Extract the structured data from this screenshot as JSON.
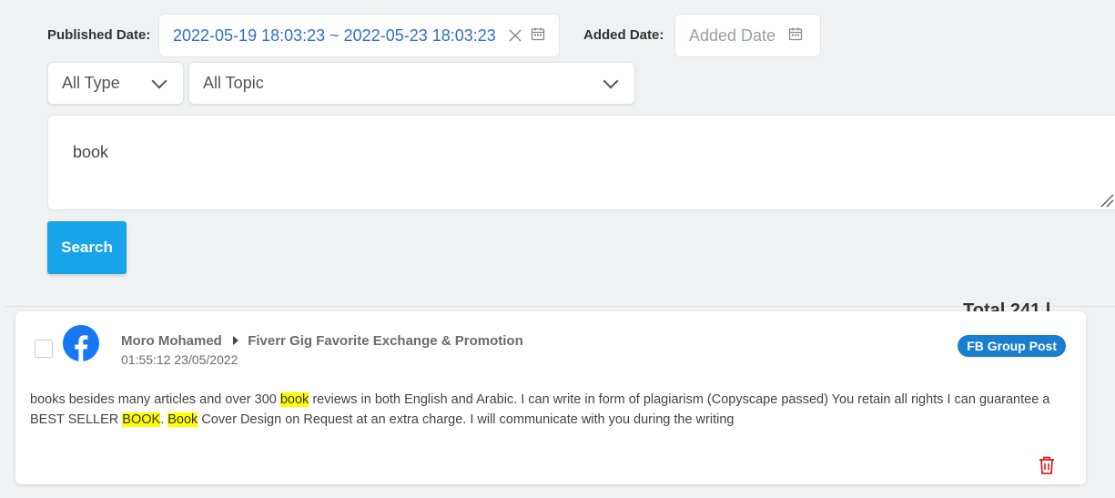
{
  "filters": {
    "published_label": "Published Date:",
    "published_value": "2022-05-19 18:03:23 ~ 2022-05-23 18:03:23",
    "added_label": "Added Date:",
    "added_placeholder": "Added Date",
    "type_select": "All Type",
    "topic_select": "All Topic",
    "keyword": "book",
    "search_label": "Search"
  },
  "total_partial": "Total 241 l",
  "post": {
    "author": "Moro Mohamed",
    "group": "Fiverr Gig Favorite Exchange & Promotion",
    "timestamp": "01:55:12 23/05/2022",
    "badge": "FB Group Post",
    "text_parts": [
      "books besides many articles and over 300 ",
      "book",
      " reviews in both English and Arabic. I can write in form of plagiarism (Copyscape passed) You retain all rights I can guarantee a BEST SELLER ",
      "BOOK",
      ". ",
      "Book",
      " Cover Design on Request at an extra charge. I will communicate with you during the writing"
    ]
  },
  "colors": {
    "accent": "#17a4e8",
    "facebook": "#1877f2",
    "badge": "#1a7ecf",
    "highlight": "#ffff00",
    "delete": "#e02020"
  },
  "icons": [
    "calendar-icon",
    "clear-icon",
    "chevron-down-icon",
    "facebook-icon",
    "caret-right-icon",
    "trash-icon"
  ]
}
